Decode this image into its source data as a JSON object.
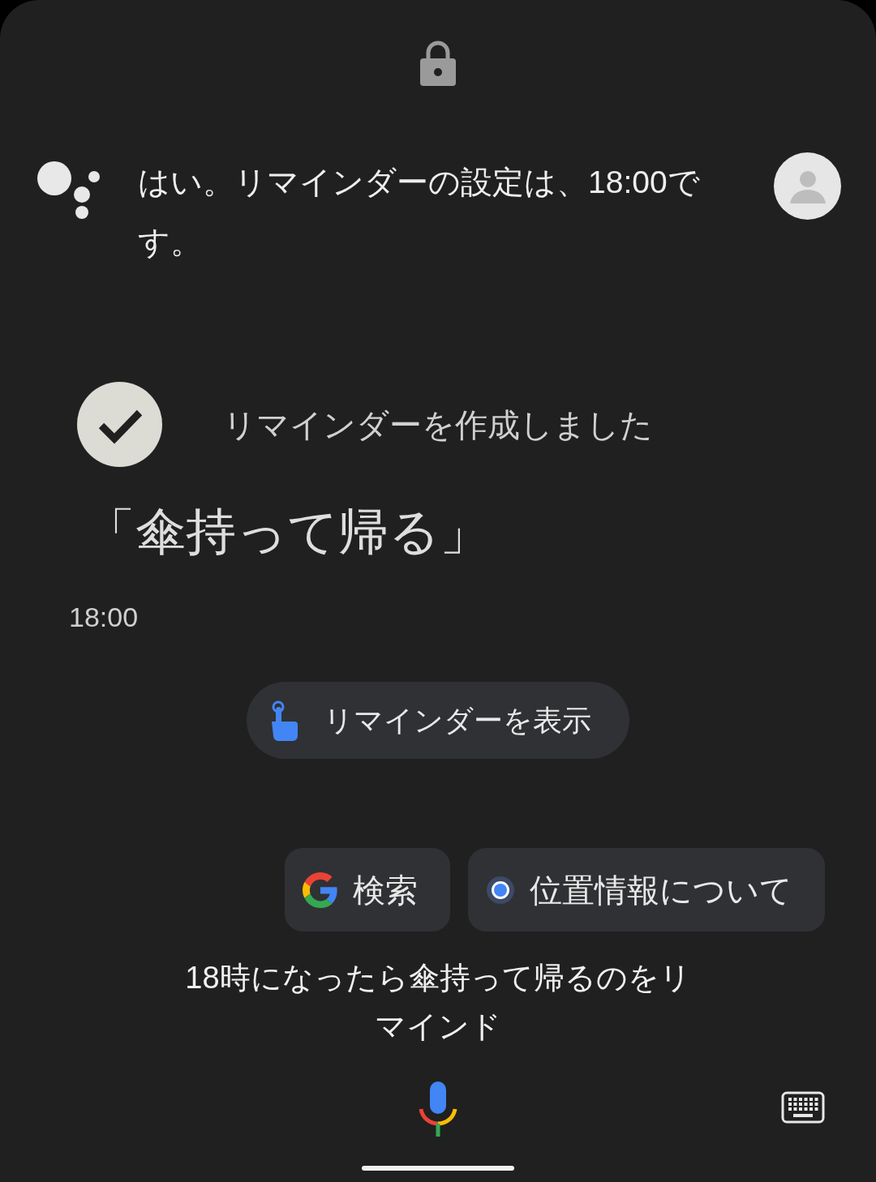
{
  "assistant_reply": "はい。リマインダーの設定は、18:00です。",
  "reminder": {
    "status": "リマインダーを作成しました",
    "title": "「傘持って帰る」",
    "time": "18:00"
  },
  "actions": [
    {
      "label": "リマインダーを表示"
    }
  ],
  "suggestions": [
    {
      "label": "検索",
      "kind": "google"
    },
    {
      "label": "位置情報について",
      "kind": "location"
    }
  ],
  "query": "18時になったら傘持って帰るのをリマインド"
}
